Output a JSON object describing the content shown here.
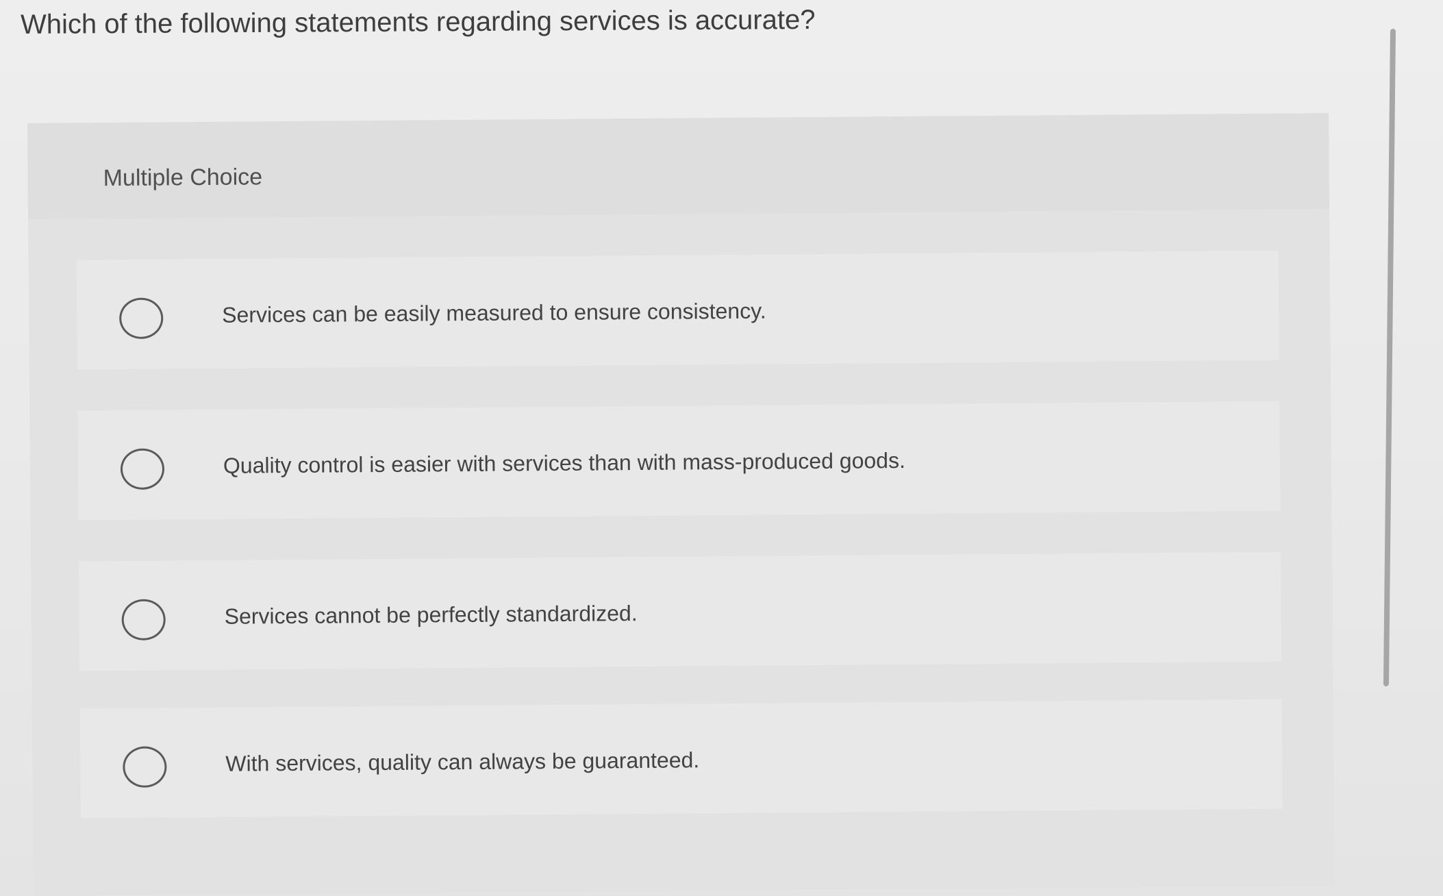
{
  "question": {
    "text": "Which of the following statements regarding services is accurate?"
  },
  "question_type": "Multiple Choice",
  "choices": [
    {
      "text": "Services can be easily measured to ensure consistency."
    },
    {
      "text": "Quality control is easier with services than with mass-produced goods."
    },
    {
      "text": "Services cannot be perfectly standardized."
    },
    {
      "text": "With services, quality can always be guaranteed."
    }
  ],
  "selected_choice": null
}
